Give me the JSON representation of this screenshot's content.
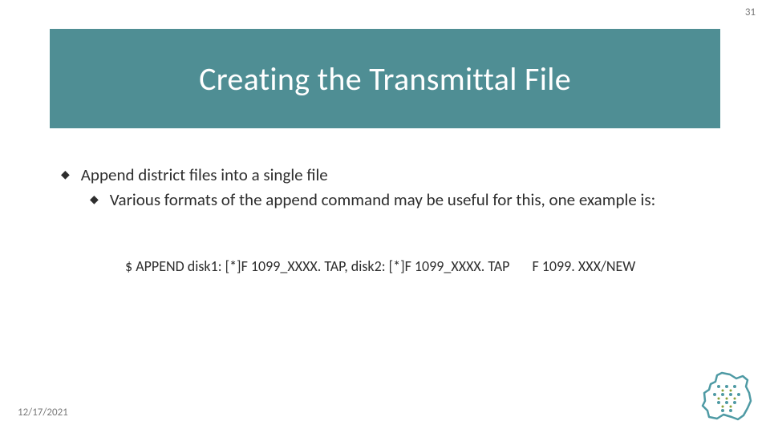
{
  "page_number": "31",
  "title": "Creating the Transmittal File",
  "bullets": {
    "level1": "Append district files into a single file",
    "level2": "Various formats of the append command may be useful for this, one example is:"
  },
  "command": {
    "text": "$ APPEND disk1: [*]F 1099_XXXX. TAP, disk2: [*]F 1099_XXXX. TAP",
    "output": "F 1099. XXX/NEW"
  },
  "footer_date": "12/17/2021",
  "colors": {
    "band": "#4f8e94",
    "outline": "#4e9aa4"
  }
}
